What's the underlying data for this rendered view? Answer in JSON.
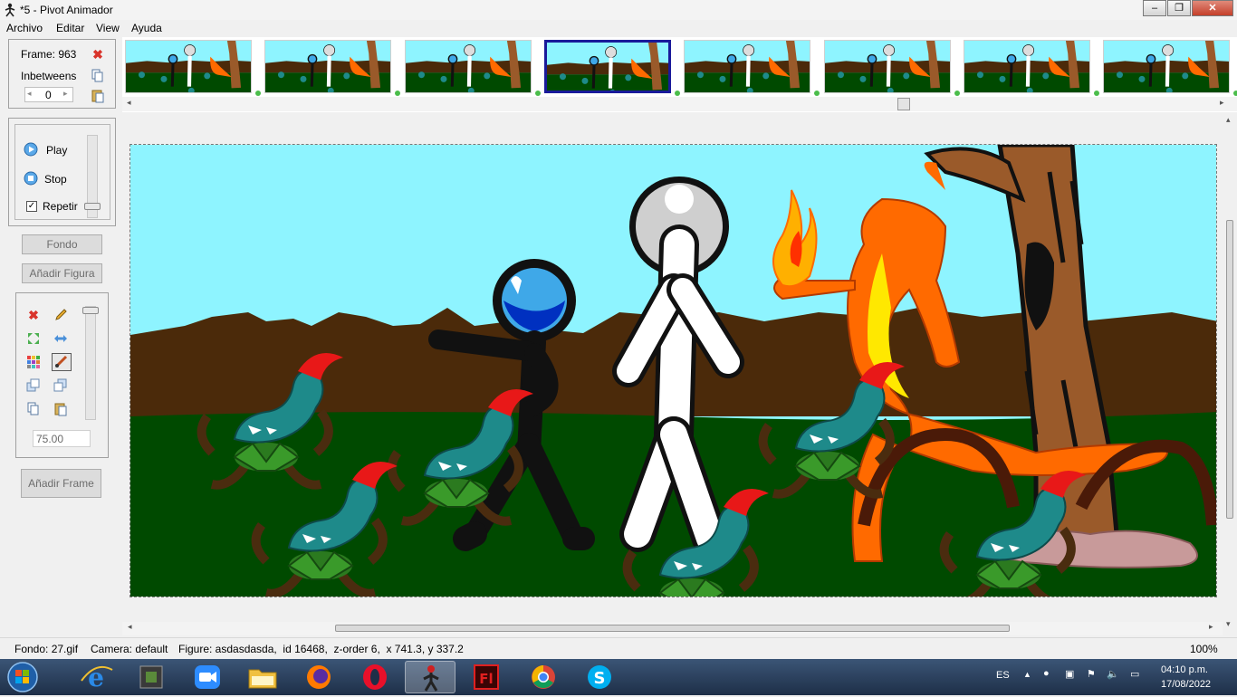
{
  "window": {
    "title": "*5 - Pivot Animador"
  },
  "menu": [
    "Archivo",
    "Editar",
    "View",
    "Ayuda"
  ],
  "frame_panel": {
    "frame_label": "Frame: 963",
    "inbetweens_label": "Inbetweens",
    "inbetweens_value": "0"
  },
  "playback": {
    "play": "Play",
    "stop": "Stop",
    "repeat": "Repetir"
  },
  "buttons": {
    "fondo": "Fondo",
    "add_figure": "Añadir Figura",
    "add_frame": "Añadir Frame"
  },
  "tools": {
    "scale_value": "75.00"
  },
  "timeline": {
    "frame_count_visible": 8,
    "selected_index": 3
  },
  "status": {
    "fondo": "Fondo: 27.gif",
    "camera": "Camera: default",
    "figure": "Figure: asdasdasda,  id 16468,  z-order 6,  x 741.3, y 337.2",
    "zoom": "100%"
  },
  "taskbar": {
    "lang": "ES",
    "time": "04:10 p.m.",
    "date": "17/08/2022",
    "apps": [
      "internet-explorer",
      "minecraft",
      "zoom",
      "file-explorer",
      "firefox",
      "opera",
      "pivot-animator",
      "flash",
      "chrome",
      "skype"
    ]
  }
}
